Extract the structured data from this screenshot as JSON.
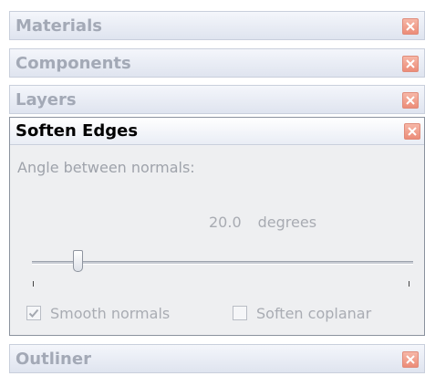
{
  "panels": {
    "materials": {
      "title": "Materials"
    },
    "components": {
      "title": "Components"
    },
    "layers": {
      "title": "Layers"
    },
    "soften_edges": {
      "title": "Soften Edges",
      "angle_label": "Angle between normals:",
      "angle_value": "20.0",
      "angle_unit": "degrees",
      "slider_fraction": 0.12,
      "smooth_normals": {
        "label": "Smooth normals",
        "checked": true
      },
      "soften_coplanar": {
        "label": "Soften coplanar",
        "checked": false
      }
    },
    "outliner": {
      "title": "Outliner"
    }
  },
  "icons": {
    "close": "close-icon"
  },
  "colors": {
    "close_button": "#ec8c78",
    "active_title": "#000000",
    "inactive_title": "#a3a9b6"
  }
}
